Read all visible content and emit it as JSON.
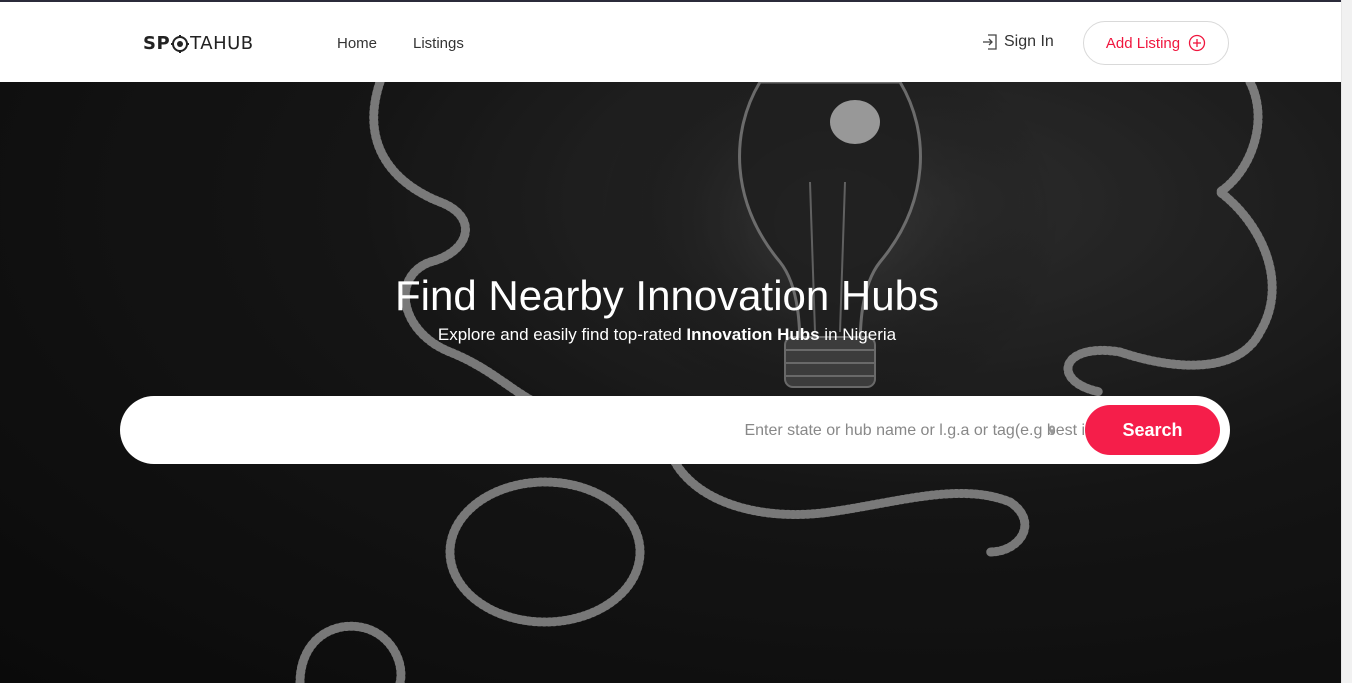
{
  "header": {
    "logo": {
      "part1": "SP",
      "part2": "TAHUB"
    },
    "nav": [
      {
        "label": "Home"
      },
      {
        "label": "Listings"
      }
    ],
    "sign_in_label": "Sign In",
    "add_listing_label": "Add Listing"
  },
  "hero": {
    "title": "Find Nearby Innovation Hubs",
    "subtitle_pre": "Explore and easily find top-rated ",
    "subtitle_bold": "Innovation Hubs",
    "subtitle_post": " in Nigeria",
    "search": {
      "placeholder": "Enter state or hub name or l.g.a or tag(e.g best in lagos)",
      "value": "",
      "button_label": "Search"
    }
  },
  "colors": {
    "accent": "#f51e4a",
    "header_bg": "#ffffff",
    "hero_bg": "#111111"
  },
  "icons": {
    "logo": "target-icon",
    "sign_in": "sign-in-icon",
    "add_listing": "plus-circle-icon",
    "location": "map-pin-icon"
  }
}
